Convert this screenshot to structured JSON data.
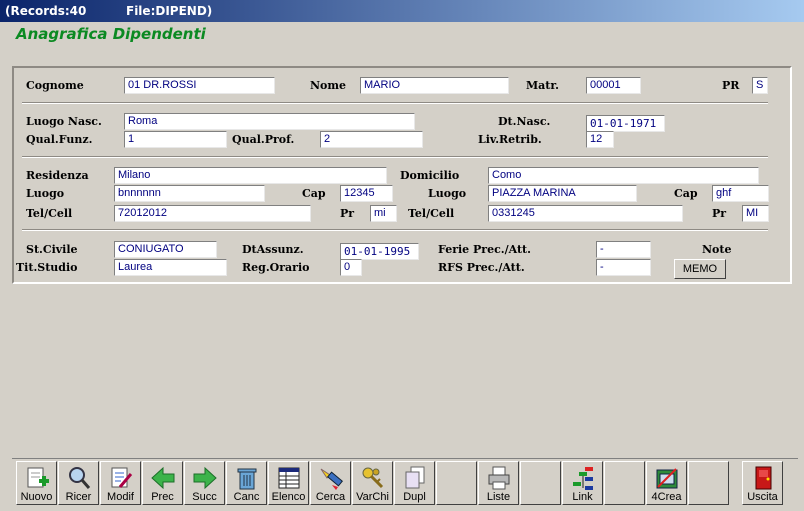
{
  "titlebar": {
    "records": "(Records:40",
    "file": "File:DIPEND)"
  },
  "form_title": "Anagrafica Dipendenti",
  "labels": {
    "cognome": "Cognome",
    "nome": "Nome",
    "matr": "Matr.",
    "pr": "PR",
    "luogo_nasc": "Luogo Nasc.",
    "dt_nasc": "Dt.Nasc.",
    "qual_funz": "Qual.Funz.",
    "qual_prof": "Qual.Prof.",
    "liv_retrib": "Liv.Retrib.",
    "residenza": "Residenza",
    "domicilio": "Domicilio",
    "luogo": "Luogo",
    "cap": "Cap",
    "luogo2": "Luogo",
    "cap2": "Cap",
    "tel_cell": "Tel/Cell",
    "pr_res": "Pr",
    "tel_cell2": "Tel/Cell",
    "pr_dom": "Pr",
    "st_civile": "St.Civile",
    "dt_assunz": "DtAssunz.",
    "ferie": "Ferie Prec./Att.",
    "note": "Note",
    "tit_studio": "Tit.Studio",
    "reg_orario": "Reg.Orario",
    "rfs": "RFS Prec./Att."
  },
  "values": {
    "cognome": "01 DR.ROSSI",
    "nome": "MARIO",
    "matr": "00001",
    "pr": "S",
    "luogo_nasc": "Roma",
    "dt_nasc": "01-01-1971",
    "qual_funz": "1",
    "qual_prof": "2",
    "liv_retrib": "12",
    "residenza": "Milano",
    "domicilio": "Como",
    "luogo_res": "bnnnnnn",
    "cap_res": "12345",
    "luogo_dom": "PIAZZA MARINA",
    "cap_dom": "ghf",
    "tel_res": "72012012",
    "pr_res": "mi",
    "tel_dom": "0331245",
    "pr_dom": "MI",
    "st_civile": "CONIUGATO",
    "dt_assunz": "01-01-1995",
    "ferie": "-",
    "tit_studio": "Laurea",
    "reg_orario": "0",
    "rfs": "-"
  },
  "memo_label": "MEMO",
  "toolbar": [
    {
      "label": "Nuovo",
      "icon": "new-document-icon"
    },
    {
      "label": "Ricer",
      "icon": "magnifier-icon"
    },
    {
      "label": "Modif",
      "icon": "edit-document-icon"
    },
    {
      "label": "Prec",
      "icon": "arrow-left-icon"
    },
    {
      "label": "Succ",
      "icon": "arrow-right-icon"
    },
    {
      "label": "Canc",
      "icon": "trash-icon"
    },
    {
      "label": "Elenco",
      "icon": "list-table-icon"
    },
    {
      "label": "Cerca",
      "icon": "search-flashlight-icon"
    },
    {
      "label": "VarChi",
      "icon": "keys-icon"
    },
    {
      "label": "Dupl",
      "icon": "duplicate-icon"
    },
    {
      "label": "",
      "icon": "empty"
    },
    {
      "label": "Liste",
      "icon": "printer-icon"
    },
    {
      "label": "",
      "icon": "empty"
    },
    {
      "label": "Link",
      "icon": "link-tree-icon"
    },
    {
      "label": "",
      "icon": "empty"
    },
    {
      "label": "4Crea",
      "icon": "create-icon"
    },
    {
      "label": "",
      "icon": "empty"
    },
    {
      "label": "Uscita",
      "icon": "exit-door-icon"
    }
  ]
}
